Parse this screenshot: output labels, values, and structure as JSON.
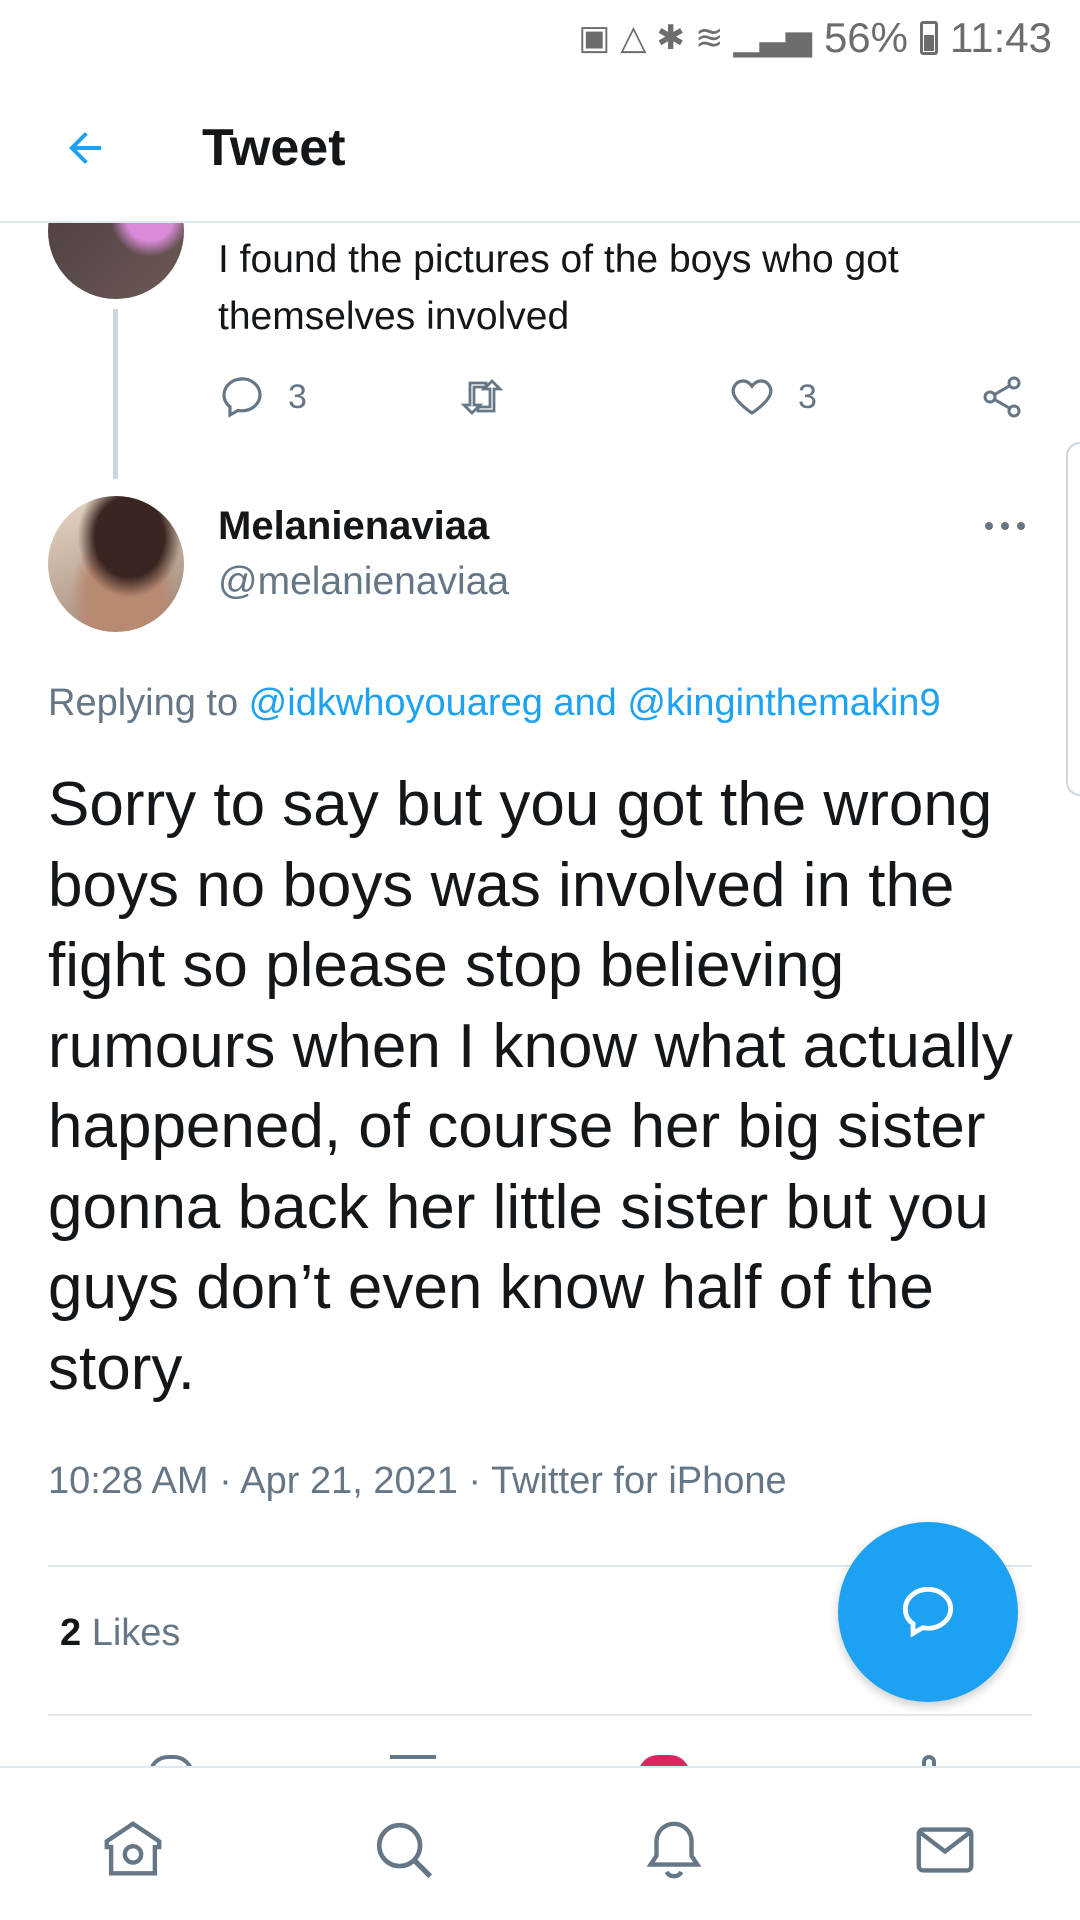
{
  "status_bar": {
    "battery": "56%",
    "time": "11:43"
  },
  "header": {
    "title": "Tweet",
    "back_icon": "arrow-left-icon"
  },
  "parent_tweet": {
    "text": "I found the pictures of the boys who got themselves involved",
    "reply_count": "3",
    "like_count": "3"
  },
  "tweet": {
    "display_name": "Melanienaviaa",
    "handle": "@melanienaviaa",
    "replying_prefix": "Replying to ",
    "mention_1": "@idkwhoyouareg",
    "mention_joiner": " and ",
    "mention_2": "@kinginthemakin9",
    "body": "Sorry to say but you got the wrong boys no boys was involved in the fight so please stop believing rumours when I know what actually happened, of course her big sister gonna back her little sister but you guys don’t even know half of the story.",
    "time": "10:28 AM",
    "date": "Apr 21, 2021",
    "source": "Twitter for iPhone",
    "sep": " · ",
    "likes_count": "2",
    "likes_label": " Likes"
  },
  "colors": {
    "accent": "#1da1f2",
    "secondary_text": "#657786",
    "like": "#e0245e"
  },
  "nav": [
    "home-icon",
    "search-icon",
    "notifications-icon",
    "messages-icon"
  ]
}
